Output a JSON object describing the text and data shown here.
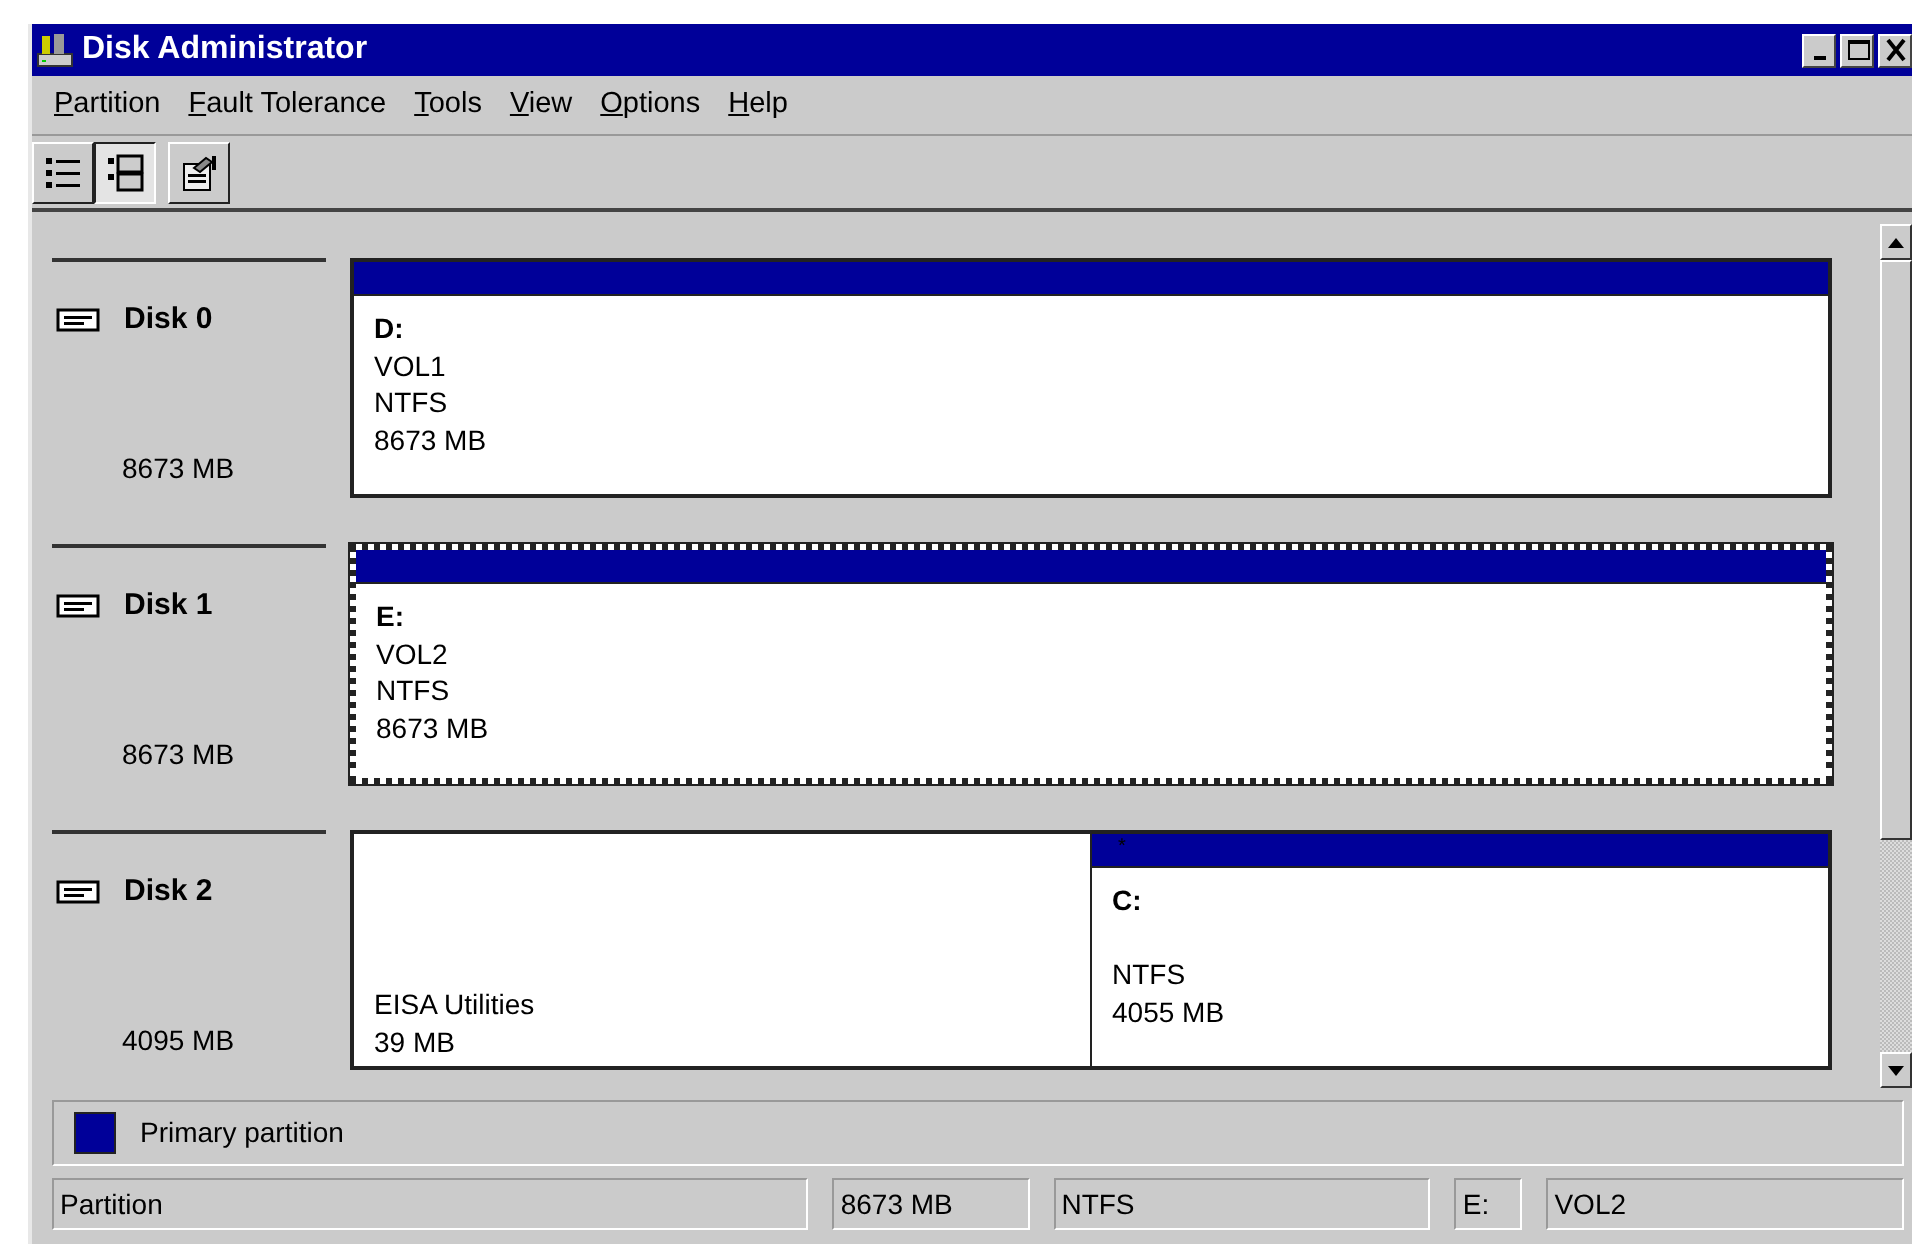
{
  "window": {
    "title": "Disk Administrator"
  },
  "menu": [
    {
      "label": "Partition"
    },
    {
      "label": "Fault Tolerance"
    },
    {
      "label": "Tools"
    },
    {
      "label": "View"
    },
    {
      "label": "Options"
    },
    {
      "label": "Help"
    }
  ],
  "toolbar": [
    {
      "kind": "volumes",
      "selected": false
    },
    {
      "kind": "disks",
      "selected": true
    },
    {
      "kind": "properties",
      "selected": false
    }
  ],
  "disks": [
    {
      "name": "Disk 0",
      "size": "8673 MB",
      "partitions": [
        {
          "kind": "primary",
          "drive": "D:",
          "volume": "VOL1",
          "fs": "NTFS",
          "size": "8673 MB",
          "selected": false
        }
      ]
    },
    {
      "name": "Disk 1",
      "size": "8673 MB",
      "partitions": [
        {
          "kind": "primary",
          "drive": "E:",
          "volume": "VOL2",
          "fs": "NTFS",
          "size": "8673 MB",
          "selected": true
        }
      ]
    },
    {
      "name": "Disk 2",
      "size": "4095 MB",
      "partitions": [
        {
          "kind": "other",
          "fs": "EISA Utilities",
          "size": "39 MB",
          "selected": false
        },
        {
          "kind": "primary",
          "drive": "C:",
          "fs": "NTFS",
          "size": "4055 MB",
          "active_mark": "*",
          "selected": false
        }
      ]
    }
  ],
  "legend": [
    {
      "label": "Primary partition",
      "color": "#000099"
    }
  ],
  "status_bar": [
    "Partition",
    "8673 MB",
    "NTFS",
    "E:",
    "VOL2"
  ]
}
